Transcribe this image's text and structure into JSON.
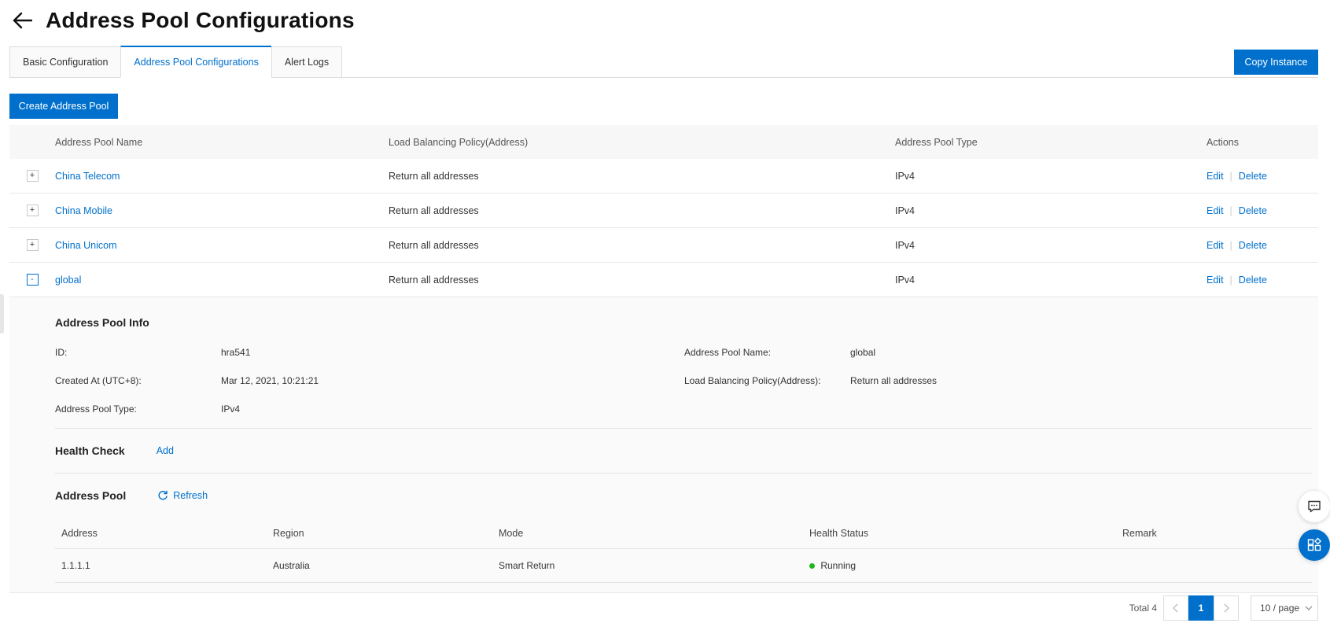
{
  "header": {
    "title": "Address Pool Configurations"
  },
  "tabs": [
    {
      "label": "Basic Configuration"
    },
    {
      "label": "Address Pool Configurations",
      "active": true
    },
    {
      "label": "Alert Logs"
    }
  ],
  "toolbar": {
    "copy_label": "Copy Instance",
    "create_label": "Create Address Pool"
  },
  "table": {
    "columns": [
      "Address Pool Name",
      "Load Balancing Policy(Address)",
      "Address Pool Type",
      "Actions"
    ],
    "rows": [
      {
        "expander": "+",
        "name": "China Telecom",
        "policy": "Return all addresses",
        "type": "IPv4",
        "edit": "Edit",
        "delete": "Delete"
      },
      {
        "expander": "+",
        "name": "China Mobile",
        "policy": "Return all addresses",
        "type": "IPv4",
        "edit": "Edit",
        "delete": "Delete"
      },
      {
        "expander": "+",
        "name": "China Unicom",
        "policy": "Return all addresses",
        "type": "IPv4",
        "edit": "Edit",
        "delete": "Delete"
      },
      {
        "expander": "-",
        "name": "global",
        "policy": "Return all addresses",
        "type": "IPv4",
        "edit": "Edit",
        "delete": "Delete"
      }
    ]
  },
  "detail": {
    "info_title": "Address Pool Info",
    "id_label": "ID:",
    "id_value": "hra541",
    "name_label": "Address Pool Name:",
    "name_value": "global",
    "created_label": "Created At (UTC+8):",
    "created_value": "Mar 12, 2021, 10:21:21",
    "policy_label": "Load Balancing Policy(Address):",
    "policy_value": "Return all addresses",
    "type_label": "Address Pool Type:",
    "type_value": "IPv4",
    "health_title": "Health Check",
    "health_add": "Add",
    "pool_title": "Address Pool",
    "pool_refresh": "Refresh",
    "sub_columns": [
      "Address",
      "Region",
      "Mode",
      "Health Status",
      "Remark"
    ],
    "sub_rows": [
      {
        "address": "1.1.1.1",
        "region": "Australia",
        "mode": "Smart Return",
        "health": "Running",
        "remark": ""
      }
    ]
  },
  "pagination": {
    "total": "Total 4",
    "current": "1",
    "page_size": "10 / page"
  },
  "colors": {
    "primary": "#0070cc",
    "running": "#1fb61f"
  },
  "icons": [
    "back-arrow-icon",
    "refresh-icon",
    "chat-icon",
    "apps-icon",
    "chevron-left-icon",
    "chevron-right-icon",
    "chevron-down-icon"
  ]
}
